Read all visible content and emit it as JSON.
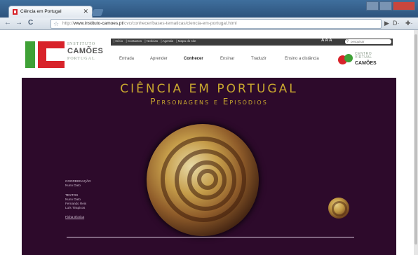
{
  "browser": {
    "tab_title": "Ciência em Portugal",
    "tab_close": "✕",
    "back_icon": "←",
    "forward_icon": "→",
    "reload_icon": "C",
    "star_icon": "☆",
    "url_prefix": "http://",
    "url_domain": "www.instituto-camoes.pt",
    "url_path": "/cvc/conhecer/bases-tematicas/ciencia-em-portugal.html",
    "go_icon": "▶",
    "page_icon": "D·",
    "wrench_icon": "✚·"
  },
  "site": {
    "logo_line1": "INSTITUTO",
    "logo_line2": "CAMÕES",
    "logo_line3": "PORTUGAL",
    "top_links": [
      "| Início",
      "| Contactos",
      "| Notícias",
      "| Agenda",
      "| Mapa do site"
    ],
    "font_size_controls": "A A A",
    "search_placeholder": "pesquisar",
    "nav": [
      "Entrada",
      "Aprender",
      "Conhecer",
      "Ensinar",
      "Traduzir",
      "Ensino a distância"
    ],
    "cvc_line1": "CENTRO",
    "cvc_line2": "VIRTUAL",
    "cvc_line3": "CAMÕES"
  },
  "content": {
    "title": "CIÊNCIA EM PORTUGAL",
    "subtitle": "Personagens e Episódios",
    "coord_heading": "COORDENAÇÃO",
    "coord_name": "Nuno Dato",
    "texts_heading": "TEXTOS",
    "authors": [
      "Nuno Dato",
      "Fernando Reis",
      "Luís Tirapicos"
    ],
    "tech_link": "Ficha técnica"
  }
}
